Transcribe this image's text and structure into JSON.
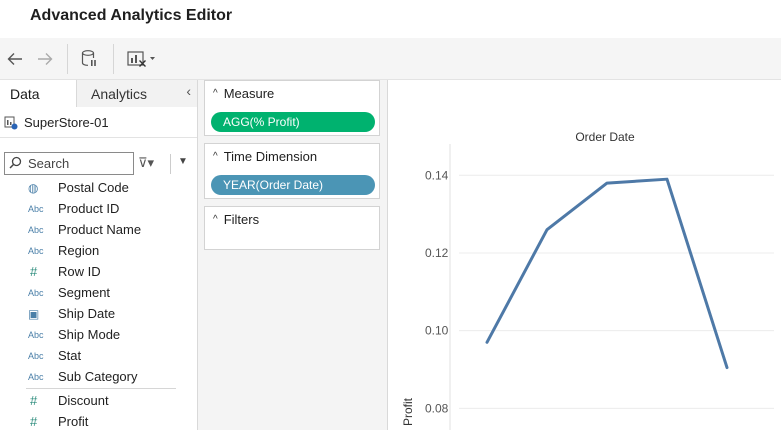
{
  "window": {
    "title": "Advanced Analytics Editor"
  },
  "toolbar": {
    "back_icon": "arrow-left-icon",
    "forward_icon": "arrow-right-icon",
    "datasource_icon": "database-pause-icon",
    "clear_icon": "chart-clear-icon"
  },
  "left_panel": {
    "tabs": {
      "data": "Data",
      "analytics": "Analytics"
    },
    "collapse_glyph": "‹",
    "datasource": "SuperStore-01",
    "search": {
      "placeholder": "Search",
      "filter_glyph": "⊽▾",
      "dropdown_glyph": "▼"
    },
    "fields": [
      {
        "type": "geo",
        "icon": "◍",
        "label": "Postal Code"
      },
      {
        "type": "string",
        "icon": "Abc",
        "label": "Product ID"
      },
      {
        "type": "string",
        "icon": "Abc",
        "label": "Product Name"
      },
      {
        "type": "string",
        "icon": "Abc",
        "label": "Region"
      },
      {
        "type": "number",
        "icon": "#",
        "label": "Row ID"
      },
      {
        "type": "string",
        "icon": "Abc",
        "label": "Segment"
      },
      {
        "type": "date",
        "icon": "▣",
        "label": "Ship Date"
      },
      {
        "type": "string",
        "icon": "Abc",
        "label": "Ship Mode"
      },
      {
        "type": "string",
        "icon": "Abc",
        "label": "Stat"
      },
      {
        "type": "string",
        "icon": "Abc",
        "label": "Sub Category"
      }
    ],
    "measures": [
      {
        "type": "number",
        "icon": "#",
        "label": "Discount"
      },
      {
        "type": "number",
        "icon": "#",
        "label": "Profit"
      }
    ]
  },
  "middle_panel": {
    "measure": {
      "header": "Measure",
      "pill": "AGG(% Profit)"
    },
    "time_dimension": {
      "header": "Time Dimension",
      "pill": "YEAR(Order Date)"
    },
    "filters": {
      "header": "Filters"
    },
    "chevron": "^"
  },
  "chart_data": {
    "type": "line",
    "title": "Order Date",
    "ylabel": "Profit",
    "xlabel": "",
    "x": [
      1,
      2,
      3,
      4,
      5
    ],
    "series": [
      {
        "values": [
          0.097,
          0.126,
          0.138,
          0.139,
          0.0905
        ]
      }
    ],
    "ylim": [
      0.077,
      0.146
    ],
    "yticks": [
      0.08,
      0.1,
      0.12,
      0.14
    ],
    "ytick_labels": [
      "0.08",
      "0.10",
      "0.12",
      "0.14"
    ],
    "grid": true,
    "line_color": "#4e79a7"
  }
}
